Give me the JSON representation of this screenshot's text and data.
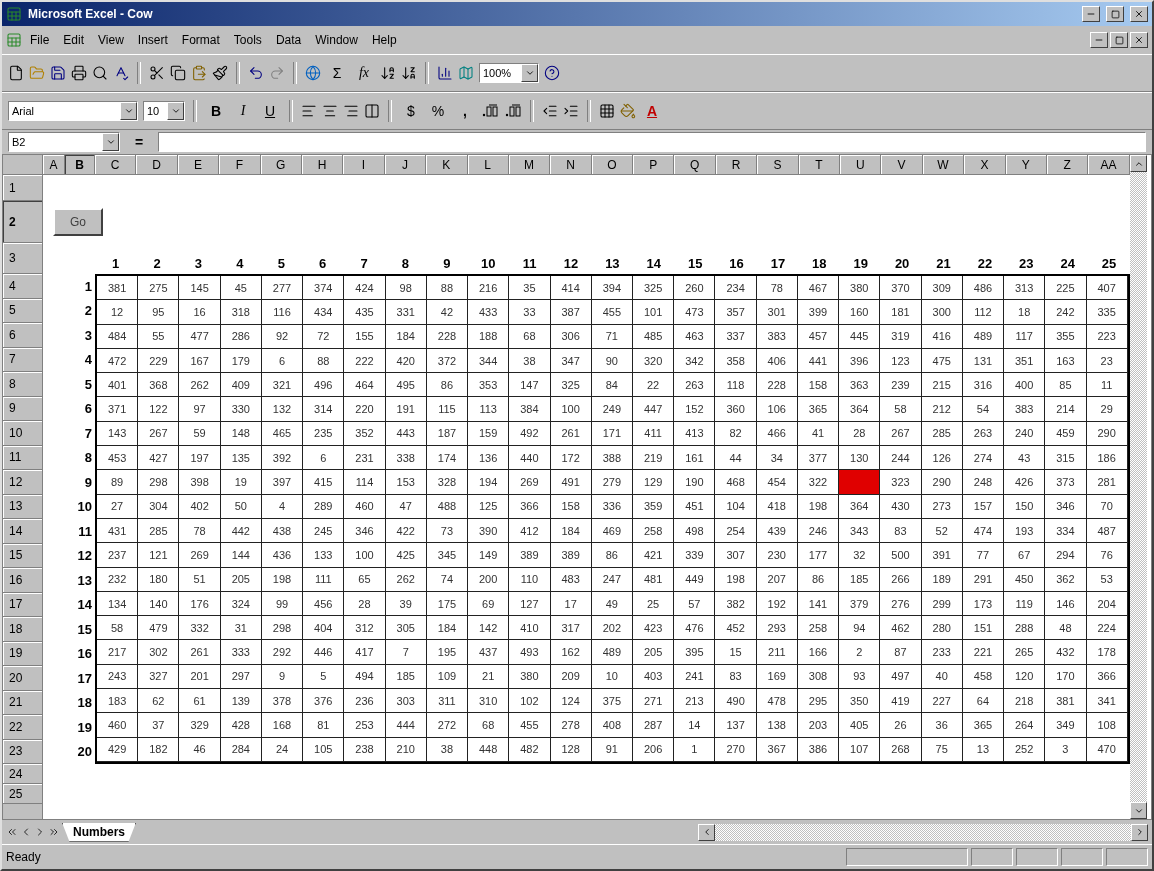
{
  "window": {
    "title": "Microsoft Excel - Cow"
  },
  "menu": [
    {
      "label": "File"
    },
    {
      "label": "Edit"
    },
    {
      "label": "View"
    },
    {
      "label": "Insert"
    },
    {
      "label": "Format"
    },
    {
      "label": "Tools"
    },
    {
      "label": "Data"
    },
    {
      "label": "Window"
    },
    {
      "label": "Help"
    }
  ],
  "standard_toolbar": {
    "sum": "Σ",
    "function": "fx",
    "zoom": "100%"
  },
  "formatting_toolbar": {
    "font": "Arial",
    "size": "10",
    "bold": "B",
    "italic": "I",
    "underline": "U",
    "currency": "$",
    "percent": "%",
    "comma": ",",
    "font_color": "A"
  },
  "formula_bar": {
    "name_box": "B2",
    "edit": "="
  },
  "sheet": {
    "column_headers": [
      {
        "label": "A",
        "selected": false
      },
      {
        "label": "B",
        "selected": true
      },
      {
        "label": "C",
        "selected": false
      },
      {
        "label": "D",
        "selected": false
      },
      {
        "label": "E",
        "selected": false
      },
      {
        "label": "F",
        "selected": false
      },
      {
        "label": "G",
        "selected": false
      },
      {
        "label": "H",
        "selected": false
      },
      {
        "label": "I",
        "selected": false
      },
      {
        "label": "J",
        "selected": false
      },
      {
        "label": "K",
        "selected": false
      },
      {
        "label": "L",
        "selected": false
      },
      {
        "label": "M",
        "selected": false
      },
      {
        "label": "N",
        "selected": false
      },
      {
        "label": "O",
        "selected": false
      },
      {
        "label": "P",
        "selected": false
      },
      {
        "label": "Q",
        "selected": false
      },
      {
        "label": "R",
        "selected": false
      },
      {
        "label": "S",
        "selected": false
      },
      {
        "label": "T",
        "selected": false
      },
      {
        "label": "U",
        "selected": false
      },
      {
        "label": "V",
        "selected": false
      },
      {
        "label": "W",
        "selected": false
      },
      {
        "label": "X",
        "selected": false
      },
      {
        "label": "Y",
        "selected": false
      },
      {
        "label": "Z",
        "selected": false
      },
      {
        "label": "AA",
        "selected": false
      }
    ],
    "row_headers": [
      {
        "label": "1",
        "selected": false
      },
      {
        "label": "2",
        "selected": true
      },
      {
        "label": "3",
        "selected": false
      },
      {
        "label": "4",
        "selected": false
      },
      {
        "label": "5",
        "selected": false
      },
      {
        "label": "6",
        "selected": false
      },
      {
        "label": "7",
        "selected": false
      },
      {
        "label": "8",
        "selected": false
      },
      {
        "label": "9",
        "selected": false
      },
      {
        "label": "10",
        "selected": false
      },
      {
        "label": "11",
        "selected": false
      },
      {
        "label": "12",
        "selected": false
      },
      {
        "label": "13",
        "selected": false
      },
      {
        "label": "14",
        "selected": false
      },
      {
        "label": "15",
        "selected": false
      },
      {
        "label": "16",
        "selected": false
      },
      {
        "label": "17",
        "selected": false
      },
      {
        "label": "18",
        "selected": false
      },
      {
        "label": "19",
        "selected": false
      },
      {
        "label": "20",
        "selected": false
      },
      {
        "label": "21",
        "selected": false
      },
      {
        "label": "22",
        "selected": false
      },
      {
        "label": "23",
        "selected": false
      },
      {
        "label": "24",
        "selected": false
      },
      {
        "label": "25",
        "selected": false
      }
    ],
    "go_button": "Go",
    "column_numbers": [
      "1",
      "2",
      "3",
      "4",
      "5",
      "6",
      "7",
      "8",
      "9",
      "10",
      "11",
      "12",
      "13",
      "14",
      "15",
      "16",
      "17",
      "18",
      "19",
      "20",
      "21",
      "22",
      "23",
      "24",
      "25"
    ],
    "rows": [
      {
        "label": "1",
        "cells": [
          "381",
          "275",
          "145",
          "45",
          "277",
          "374",
          "424",
          "98",
          "88",
          "216",
          "35",
          "414",
          "394",
          "325",
          "260",
          "234",
          "78",
          "467",
          "380",
          "370",
          "309",
          "486",
          "313",
          "225",
          "407"
        ]
      },
      {
        "label": "2",
        "cells": [
          "12",
          "95",
          "16",
          "318",
          "116",
          "434",
          "435",
          "331",
          "42",
          "433",
          "33",
          "387",
          "455",
          "101",
          "473",
          "357",
          "301",
          "399",
          "160",
          "181",
          "300",
          "112",
          "18",
          "242",
          "335"
        ]
      },
      {
        "label": "3",
        "cells": [
          "484",
          "55",
          "477",
          "286",
          "92",
          "72",
          "155",
          "184",
          "228",
          "188",
          "68",
          "306",
          "71",
          "485",
          "463",
          "337",
          "383",
          "457",
          "445",
          "319",
          "416",
          "489",
          "117",
          "355",
          "223"
        ]
      },
      {
        "label": "4",
        "cells": [
          "472",
          "229",
          "167",
          "179",
          "6",
          "88",
          "222",
          "420",
          "372",
          "344",
          "38",
          "347",
          "90",
          "320",
          "342",
          "358",
          "406",
          "441",
          "396",
          "123",
          "475",
          "131",
          "351",
          "163",
          "23"
        ]
      },
      {
        "label": "5",
        "cells": [
          "401",
          "368",
          "262",
          "409",
          "321",
          "496",
          "464",
          "495",
          "86",
          "353",
          "147",
          "325",
          "84",
          "22",
          "263",
          "118",
          "228",
          "158",
          "363",
          "239",
          "215",
          "316",
          "400",
          "85",
          "11"
        ]
      },
      {
        "label": "6",
        "cells": [
          "371",
          "122",
          "97",
          "330",
          "132",
          "314",
          "220",
          "191",
          "115",
          "113",
          "384",
          "100",
          "249",
          "447",
          "152",
          "360",
          "106",
          "365",
          "364",
          "58",
          "212",
          "54",
          "383",
          "214",
          "29"
        ]
      },
      {
        "label": "7",
        "cells": [
          "143",
          "267",
          "59",
          "148",
          "465",
          "235",
          "352",
          "443",
          "187",
          "159",
          "492",
          "261",
          "171",
          "411",
          "413",
          "82",
          "466",
          "41",
          "28",
          "267",
          "285",
          "263",
          "240",
          "459",
          "290"
        ]
      },
      {
        "label": "8",
        "cells": [
          "453",
          "427",
          "197",
          "135",
          "392",
          "6",
          "231",
          "338",
          "174",
          "136",
          "440",
          "172",
          "388",
          "219",
          "161",
          "44",
          "34",
          "377",
          "130",
          "244",
          "126",
          "274",
          "43",
          "315",
          "186"
        ]
      },
      {
        "label": "9",
        "cells": [
          "89",
          "298",
          "398",
          "19",
          "397",
          "415",
          "114",
          "153",
          "328",
          "194",
          "269",
          "491",
          "279",
          "129",
          "190",
          "468",
          "454",
          "322",
          {
            "highlighted": true
          },
          "323",
          "290",
          "248",
          "426",
          "373",
          "281"
        ]
      },
      {
        "label": "10",
        "cells": [
          "27",
          "304",
          "402",
          "50",
          "4",
          "289",
          "460",
          "47",
          "488",
          "125",
          "366",
          "158",
          "336",
          "359",
          "451",
          "104",
          "418",
          "198",
          "364",
          "430",
          "273",
          "157",
          "150",
          "346",
          "70"
        ]
      },
      {
        "label": "11",
        "cells": [
          "431",
          "285",
          "78",
          "442",
          "438",
          "245",
          "346",
          "422",
          "73",
          "390",
          "412",
          "184",
          "469",
          "258",
          "498",
          "254",
          "439",
          "246",
          "343",
          "83",
          "52",
          "474",
          "193",
          "334",
          "487"
        ]
      },
      {
        "label": "12",
        "cells": [
          "237",
          "121",
          "269",
          "144",
          "436",
          "133",
          "100",
          "425",
          "345",
          "149",
          "389",
          "389",
          "86",
          "421",
          "339",
          "307",
          "230",
          "177",
          "32",
          "500",
          "391",
          "77",
          "67",
          "294",
          "76"
        ]
      },
      {
        "label": "13",
        "cells": [
          "232",
          "180",
          "51",
          "205",
          "198",
          "111",
          "65",
          "262",
          "74",
          "200",
          "110",
          "483",
          "247",
          "481",
          "449",
          "198",
          "207",
          "86",
          "185",
          "266",
          "189",
          "291",
          "450",
          "362",
          "53"
        ]
      },
      {
        "label": "14",
        "cells": [
          "134",
          "140",
          "176",
          "324",
          "99",
          "456",
          "28",
          "39",
          "175",
          "69",
          "127",
          "17",
          "49",
          "25",
          "57",
          "382",
          "192",
          "141",
          "379",
          "276",
          "299",
          "173",
          "119",
          "146",
          "204"
        ]
      },
      {
        "label": "15",
        "cells": [
          "58",
          "479",
          "332",
          "31",
          "298",
          "404",
          "312",
          "305",
          "184",
          "142",
          "410",
          "317",
          "202",
          "423",
          "476",
          "452",
          "293",
          "258",
          "94",
          "462",
          "280",
          "151",
          "288",
          "48",
          "224"
        ]
      },
      {
        "label": "16",
        "cells": [
          "217",
          "302",
          "261",
          "333",
          "292",
          "446",
          "417",
          "7",
          "195",
          "437",
          "493",
          "162",
          "489",
          "205",
          "395",
          "15",
          "211",
          "166",
          "2",
          "87",
          "233",
          "221",
          "265",
          "432",
          "178"
        ]
      },
      {
        "label": "17",
        "cells": [
          "243",
          "327",
          "201",
          "297",
          "9",
          "5",
          "494",
          "185",
          "109",
          "21",
          "380",
          "209",
          "10",
          "403",
          "241",
          "83",
          "169",
          "308",
          "93",
          "497",
          "40",
          "458",
          "120",
          "170",
          "366"
        ]
      },
      {
        "label": "18",
        "cells": [
          "183",
          "62",
          "61",
          "139",
          "378",
          "376",
          "236",
          "303",
          "311",
          "310",
          "102",
          "124",
          "375",
          "271",
          "213",
          "490",
          "478",
          "295",
          "350",
          "419",
          "227",
          "64",
          "218",
          "381",
          "341"
        ]
      },
      {
        "label": "19",
        "cells": [
          "460",
          "37",
          "329",
          "428",
          "168",
          "81",
          "253",
          "444",
          "272",
          "68",
          "455",
          "278",
          "408",
          "287",
          "14",
          "137",
          "138",
          "203",
          "405",
          "26",
          "36",
          "365",
          "264",
          "349",
          "108"
        ]
      },
      {
        "label": "20",
        "cells": [
          "429",
          "182",
          "46",
          "284",
          "24",
          "105",
          "238",
          "210",
          "38",
          "448",
          "482",
          "128",
          "91",
          "206",
          "1",
          "270",
          "367",
          "386",
          "107",
          "268",
          "75",
          "13",
          "252",
          "3",
          "470"
        ]
      }
    ]
  },
  "sheet_tabs": [
    {
      "label": "Numbers",
      "selected": true
    }
  ],
  "status_bar": {
    "text": "Ready"
  }
}
